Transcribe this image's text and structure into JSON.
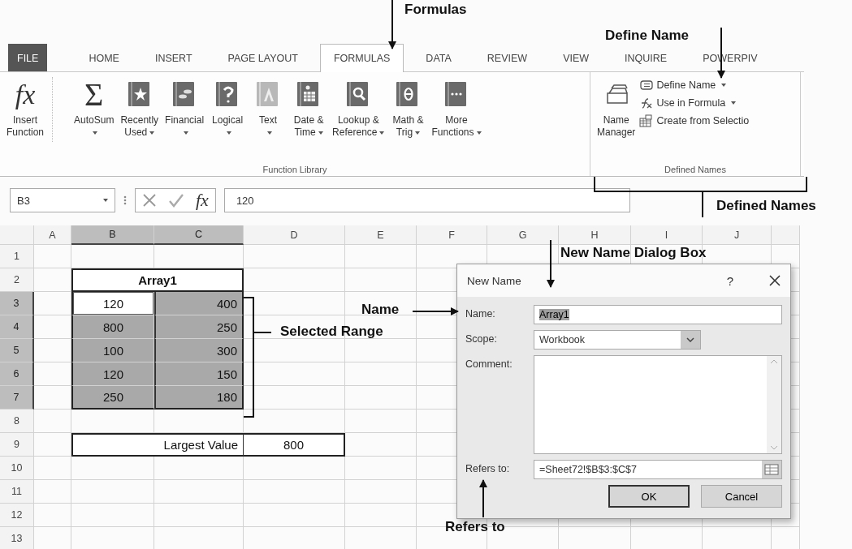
{
  "ribbon": {
    "tabs": [
      {
        "label": "FILE",
        "kind": "file",
        "selected": false
      },
      {
        "label": "HOME",
        "kind": "tab",
        "selected": false
      },
      {
        "label": "INSERT",
        "kind": "tab",
        "selected": false
      },
      {
        "label": "PAGE LAYOUT",
        "kind": "tab",
        "selected": false
      },
      {
        "label": "FORMULAS",
        "kind": "tab",
        "selected": true
      },
      {
        "label": "DATA",
        "kind": "tab",
        "selected": false
      },
      {
        "label": "REVIEW",
        "kind": "tab",
        "selected": false
      },
      {
        "label": "VIEW",
        "kind": "tab",
        "selected": false
      },
      {
        "label": "INQUIRE",
        "kind": "tab",
        "selected": false
      },
      {
        "label": "POWERPIV",
        "kind": "tab",
        "selected": false
      }
    ],
    "groups": [
      {
        "label": "Function Library",
        "commands": [
          {
            "kind": "large",
            "label": "Insert\nFunction",
            "glyph": "fx",
            "dropdown": false
          },
          {
            "kind": "large",
            "label": "AutoSum",
            "glyph": "Σ",
            "dropdown": true
          },
          {
            "kind": "large",
            "label": "Recently\nUsed",
            "dropdown": true
          },
          {
            "kind": "large",
            "label": "Financial",
            "dropdown": true
          },
          {
            "kind": "large",
            "label": "Logical",
            "dropdown": true
          },
          {
            "kind": "large",
            "label": "Text",
            "dropdown": true
          },
          {
            "kind": "large",
            "label": "Date &\nTime",
            "dropdown": true
          },
          {
            "kind": "large",
            "label": "Lookup &\nReference",
            "dropdown": true
          },
          {
            "kind": "large",
            "label": "Math &\nTrig",
            "dropdown": true
          },
          {
            "kind": "large",
            "label": "More\nFunctions",
            "dropdown": true
          }
        ]
      },
      {
        "label": "Defined Names",
        "commands": [
          {
            "kind": "large",
            "label": "Name\nManager",
            "dropdown": false
          },
          {
            "kind": "small",
            "label": "Define Name",
            "dropdown": true
          },
          {
            "kind": "small",
            "label": "Use in Formula",
            "dropdown": true
          },
          {
            "kind": "small",
            "label": "Create from Selectio",
            "dropdown": false
          }
        ]
      }
    ]
  },
  "formula_bar": {
    "name_box": "B3",
    "function_glyph": "fx",
    "value": "120"
  },
  "sheet": {
    "columns": [
      {
        "label": "A",
        "selected": false
      },
      {
        "label": "B",
        "selected": true
      },
      {
        "label": "C",
        "selected": true
      },
      {
        "label": "D",
        "selected": false
      },
      {
        "label": "E",
        "selected": false
      },
      {
        "label": "F",
        "selected": false
      },
      {
        "label": "G",
        "selected": false
      },
      {
        "label": "H",
        "selected": false
      },
      {
        "label": "I",
        "selected": false
      },
      {
        "label": "J",
        "selected": false
      }
    ],
    "rows": [
      {
        "label": "1",
        "selected": false
      },
      {
        "label": "2",
        "selected": false
      },
      {
        "label": "3",
        "selected": true
      },
      {
        "label": "4",
        "selected": true
      },
      {
        "label": "5",
        "selected": true
      },
      {
        "label": "6",
        "selected": true
      },
      {
        "label": "7",
        "selected": true
      },
      {
        "label": "8",
        "selected": false
      },
      {
        "label": "9",
        "selected": false
      },
      {
        "label": "10",
        "selected": false
      },
      {
        "label": "11",
        "selected": false
      },
      {
        "label": "12",
        "selected": false
      },
      {
        "label": "13",
        "selected": false
      }
    ],
    "array_title": "Array1",
    "array_rows": [
      {
        "cells": [
          {
            "text": "120",
            "selected": true,
            "active": true
          },
          {
            "text": "400",
            "selected": true,
            "active": false
          }
        ]
      },
      {
        "cells": [
          {
            "text": "800",
            "selected": true,
            "active": false
          },
          {
            "text": "250",
            "selected": true,
            "active": false
          }
        ]
      },
      {
        "cells": [
          {
            "text": "100",
            "selected": true,
            "active": false
          },
          {
            "text": "300",
            "selected": true,
            "active": false
          }
        ]
      },
      {
        "cells": [
          {
            "text": "120",
            "selected": true,
            "active": false
          },
          {
            "text": "150",
            "selected": true,
            "active": false
          }
        ]
      },
      {
        "cells": [
          {
            "text": "250",
            "selected": true,
            "active": false
          },
          {
            "text": "180",
            "selected": true,
            "active": false
          }
        ]
      }
    ],
    "result": {
      "label": "Largest Value",
      "value": "800"
    }
  },
  "dialog": {
    "title": "New Name",
    "help": "?",
    "fields": [
      {
        "kind": "text",
        "label": "Name:",
        "value": "Array1",
        "value_selected": true
      },
      {
        "kind": "select",
        "label": "Scope:",
        "value": "Workbook"
      },
      {
        "kind": "textarea",
        "label": "Comment:"
      },
      {
        "kind": "range",
        "label": "Refers to:",
        "value": "=Sheet72!$B$3:$C$7"
      }
    ],
    "buttons": [
      {
        "label": "OK",
        "default": true
      },
      {
        "label": "Cancel",
        "default": false
      }
    ]
  },
  "annotations": [
    {
      "kind": "arrow",
      "text": "Formulas"
    },
    {
      "kind": "arrow",
      "text": "Define Name"
    },
    {
      "kind": "bracket",
      "text": "Defined Names"
    },
    {
      "kind": "arrow",
      "text": "New Name Dialog Box"
    },
    {
      "kind": "arrow",
      "text": "Name"
    },
    {
      "kind": "bracket",
      "text": "Selected Range"
    },
    {
      "kind": "arrow",
      "text": "Refers to"
    }
  ]
}
